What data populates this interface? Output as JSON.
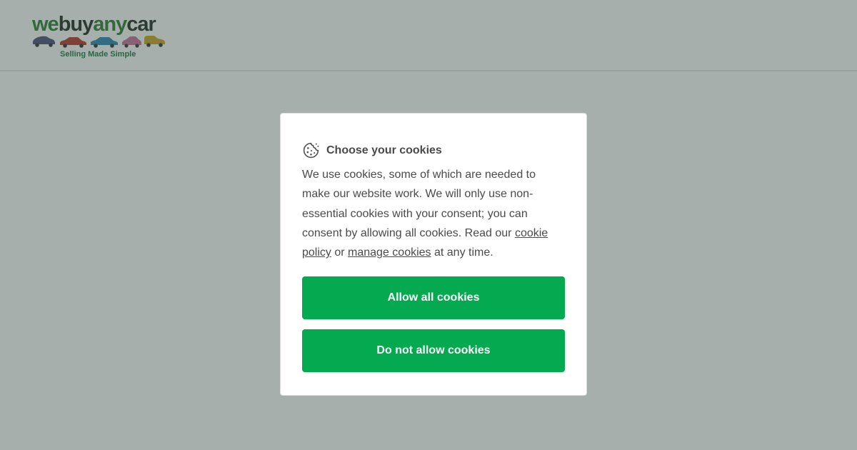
{
  "header": {
    "logo": {
      "word_parts": [
        {
          "text": "we",
          "color": "#2e7d32"
        },
        {
          "text": "buy",
          "color": "#1f2e26"
        },
        {
          "text": "any",
          "color": "#2e7d32"
        },
        {
          "text": "car",
          "color": "#1f2e26"
        }
      ],
      "tagline": "Selling Made Simple",
      "tagline_color": "#1b7a3d",
      "car_colors": [
        "#4b4e7c",
        "#b43a2e",
        "#2a86b0",
        "#c76f9a",
        "#c8a526"
      ]
    }
  },
  "cookie_dialog": {
    "icon": "cookie-icon",
    "title": "Choose your cookies",
    "body_text_1": "We use cookies, some of which are needed to make our website work. We will only use non-essential cookies with your consent; you can consent by allowing all cookies. Read our ",
    "cookie_policy_link": "cookie policy",
    "body_text_2": " or ",
    "manage_cookies_link": "manage cookies",
    "body_text_3": " at any time.",
    "allow_button": "Allow all cookies",
    "deny_button": "Do not allow cookies",
    "button_color": "#05a94f"
  },
  "overlay_color": "rgba(60, 78, 70, 0.45)"
}
